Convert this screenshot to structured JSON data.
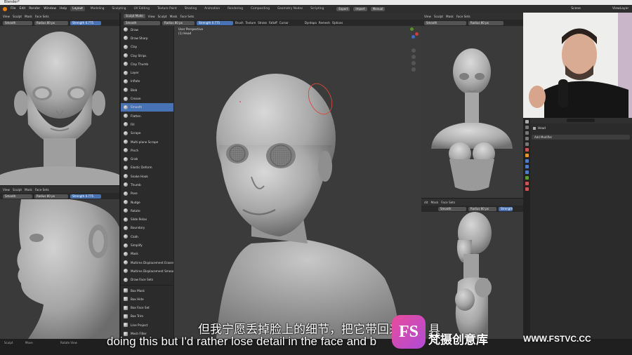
{
  "window": {
    "title": "Blender*"
  },
  "menu": [
    "File",
    "Edit",
    "Render",
    "Window",
    "Help"
  ],
  "workspaces": [
    "Layout",
    "Modeling",
    "Sculpting",
    "UV Editing",
    "Texture Paint",
    "Shading",
    "Animation",
    "Rendering",
    "Compositing",
    "Geometry Nodes",
    "Scripting"
  ],
  "active_workspace": "Layout",
  "topbar_right": {
    "export": "Export",
    "import": "Import",
    "manual": "Manual",
    "scene": "Scene",
    "view_layer": "ViewLayer"
  },
  "left_viewport": {
    "menu": [
      "View",
      "Sculpt",
      "Mask",
      "Face Sets"
    ],
    "brush": "Smooth",
    "radius_label": "Radius",
    "radius_value": "80 px",
    "strength_label": "Strength",
    "strength_value": "0.775"
  },
  "left_bottom_viewport": {
    "menu": [
      "View",
      "Sculpt",
      "Mask",
      "Face Sets"
    ],
    "brush": "Smooth",
    "radius_label": "Radius",
    "radius_value": "80 px",
    "strength_label": "Strength",
    "strength_value": "0.775"
  },
  "main_viewport": {
    "mode": "Sculpt Mode",
    "menu": [
      "View",
      "Sculpt",
      "Mask",
      "Face Sets"
    ],
    "brush": "Smooth",
    "radius_label": "Radius",
    "radius_value": "80 px",
    "strength_label": "Strength",
    "strength_value": "0.775",
    "tool_menus": [
      "Brush",
      "Texture",
      "Stroke",
      "Falloff",
      "Cursor"
    ],
    "dyntopo": "Dyntopo",
    "remesh": "Remesh",
    "options": "Options",
    "view_name": "User Perspective",
    "object_name": "(1) Head"
  },
  "brushes": [
    "Draw",
    "Draw Sharp",
    "Clay",
    "Clay Strips",
    "Clay Thumb",
    "Layer",
    "Inflate",
    "Blob",
    "Crease",
    "Smooth",
    "Flatten",
    "Fill",
    "Scrape",
    "Multi-plane Scrape",
    "Pinch",
    "Grab",
    "Elastic Deform",
    "Snake Hook",
    "Thumb",
    "Pose",
    "Nudge",
    "Rotate",
    "Slide Relax",
    "Boundary",
    "Cloth",
    "Simplify",
    "Mask",
    "Multires Displacement Eraser",
    "Multires Displacement Smear",
    "Draw Face Sets",
    "Box Mask",
    "Box Hide",
    "Box Face Set",
    "Box Trim",
    "Line Project",
    "Mesh Filter"
  ],
  "active_brush": "Smooth",
  "right_top_viewport": {
    "menu": [
      "View",
      "Sculpt",
      "Mask",
      "Face Sets"
    ],
    "brush": "Smooth",
    "radius_label": "Radius",
    "radius_value": "80 px"
  },
  "right_bottom_viewport": {
    "menu": [
      "dit",
      "Mask",
      "Face Sets"
    ],
    "brush": "Smooth",
    "radius_label": "Radius",
    "radius_value": "80 px",
    "strength_label": "Strength"
  },
  "properties": {
    "object": "Head",
    "add_modifier": "Add Modifier"
  },
  "statusbar": {
    "sculpt": "Sculpt",
    "move": "Move",
    "rotate": "Rotate View"
  },
  "subtitles": {
    "chinese": "但我宁愿丢掉脸上的细节，把它带回来",
    "chinese_tail": "具",
    "english": "doing this but I'd rather lose detail in the face and b"
  },
  "watermark": {
    "logo": "FS",
    "brand": "梵摄创意库",
    "url": "WWW.FSTVC.CC"
  },
  "colors": {
    "accent": "#4772b3",
    "viewport": "#3a3a3a",
    "brush_circle": "#d9483b"
  }
}
